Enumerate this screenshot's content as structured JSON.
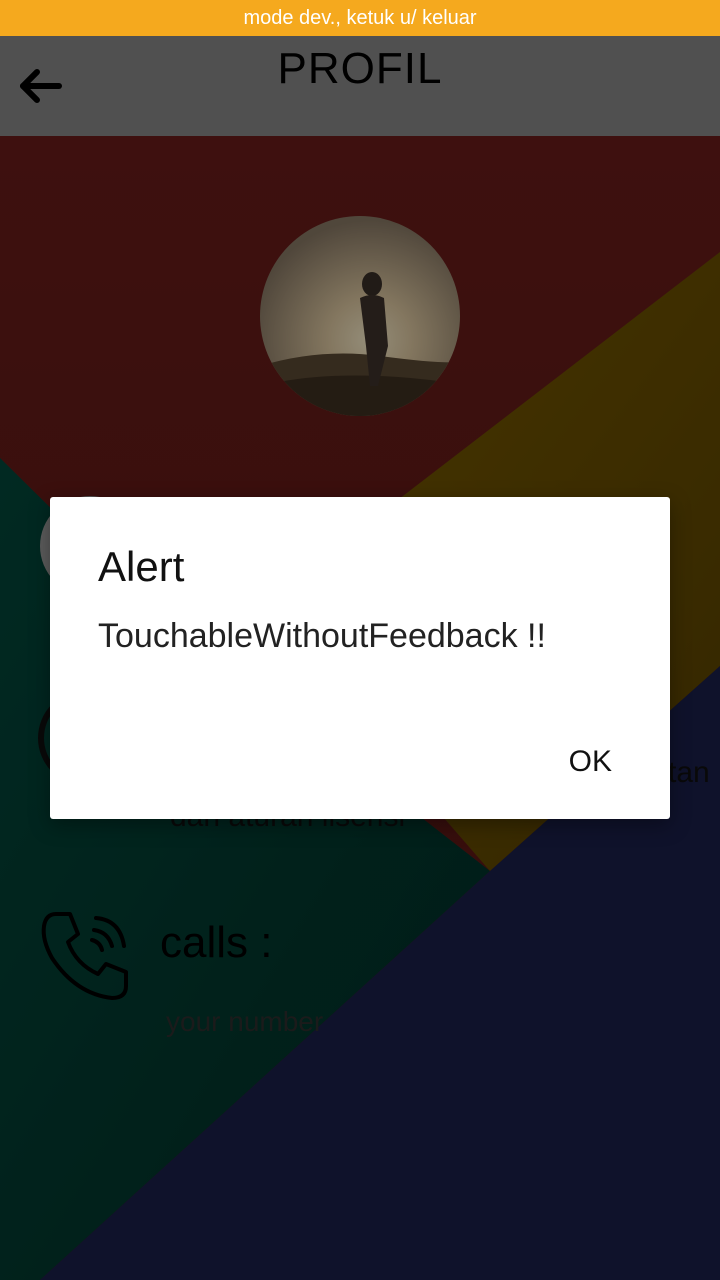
{
  "dev_banner": "mode dev., ketuk u/ keluar",
  "header": {
    "title": "PROFIL",
    "back_icon": "arrow-left-icon"
  },
  "background": {
    "colors": {
      "red": "#6b1d1a",
      "yellow": "#7a5a00",
      "green": "#024236",
      "navy": "#1a1f4a"
    }
  },
  "profile": {
    "avatar_icon": "profile-photo"
  },
  "rows": {
    "partial_right_text": "tan",
    "partial_below_text": "dan aturan lisensi",
    "calls_label": "calls :",
    "calls_icon": "phone-ringing-icon",
    "number_placeholder": "your number"
  },
  "dialog": {
    "title": "Alert",
    "message": "TouchableWithoutFeedback !!",
    "ok_label": "OK"
  }
}
